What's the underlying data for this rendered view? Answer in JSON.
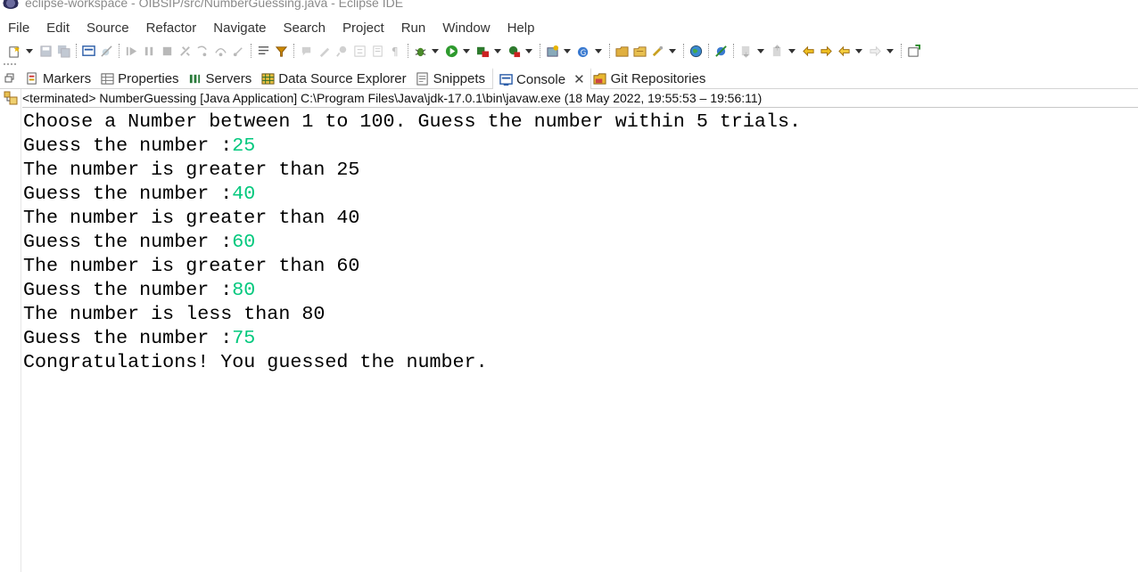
{
  "window": {
    "title": "eclipse-workspace - OIBSIP/src/NumberGuessing.java - Eclipse IDE"
  },
  "menu": [
    "File",
    "Edit",
    "Source",
    "Refactor",
    "Navigate",
    "Search",
    "Project",
    "Run",
    "Window",
    "Help"
  ],
  "tabs": [
    {
      "label": "Markers",
      "icon": "markers-icon"
    },
    {
      "label": "Properties",
      "icon": "properties-icon"
    },
    {
      "label": "Servers",
      "icon": "servers-icon"
    },
    {
      "label": "Data Source Explorer",
      "icon": "data-source-explorer-icon"
    },
    {
      "label": "Snippets",
      "icon": "snippets-icon"
    },
    {
      "label": "Console",
      "icon": "console-icon",
      "active": true
    },
    {
      "label": "Git Repositories",
      "icon": "git-repositories-icon"
    }
  ],
  "console": {
    "header": "<terminated> NumberGuessing [Java Application] C:\\Program Files\\Java\\jdk-17.0.1\\bin\\javaw.exe  (18 May 2022, 19:55:53 – 19:56:11)",
    "lines": [
      {
        "text": "Choose a Number between 1 to 100. Guess the number within 5 trials.",
        "input": ""
      },
      {
        "text": "Guess the number :",
        "input": "25"
      },
      {
        "text": "The number is greater than 25",
        "input": ""
      },
      {
        "text": "Guess the number :",
        "input": "40"
      },
      {
        "text": "The number is greater than 40",
        "input": ""
      },
      {
        "text": "Guess the number :",
        "input": "60"
      },
      {
        "text": "The number is greater than 60",
        "input": ""
      },
      {
        "text": "Guess the number :",
        "input": "80"
      },
      {
        "text": "The number is less than 80",
        "input": ""
      },
      {
        "text": "Guess the number :",
        "input": "75"
      },
      {
        "text": "Congratulations! You guessed the number.",
        "input": ""
      }
    ]
  },
  "colors": {
    "user_input": "#00c87d",
    "output_text": "#000000"
  }
}
